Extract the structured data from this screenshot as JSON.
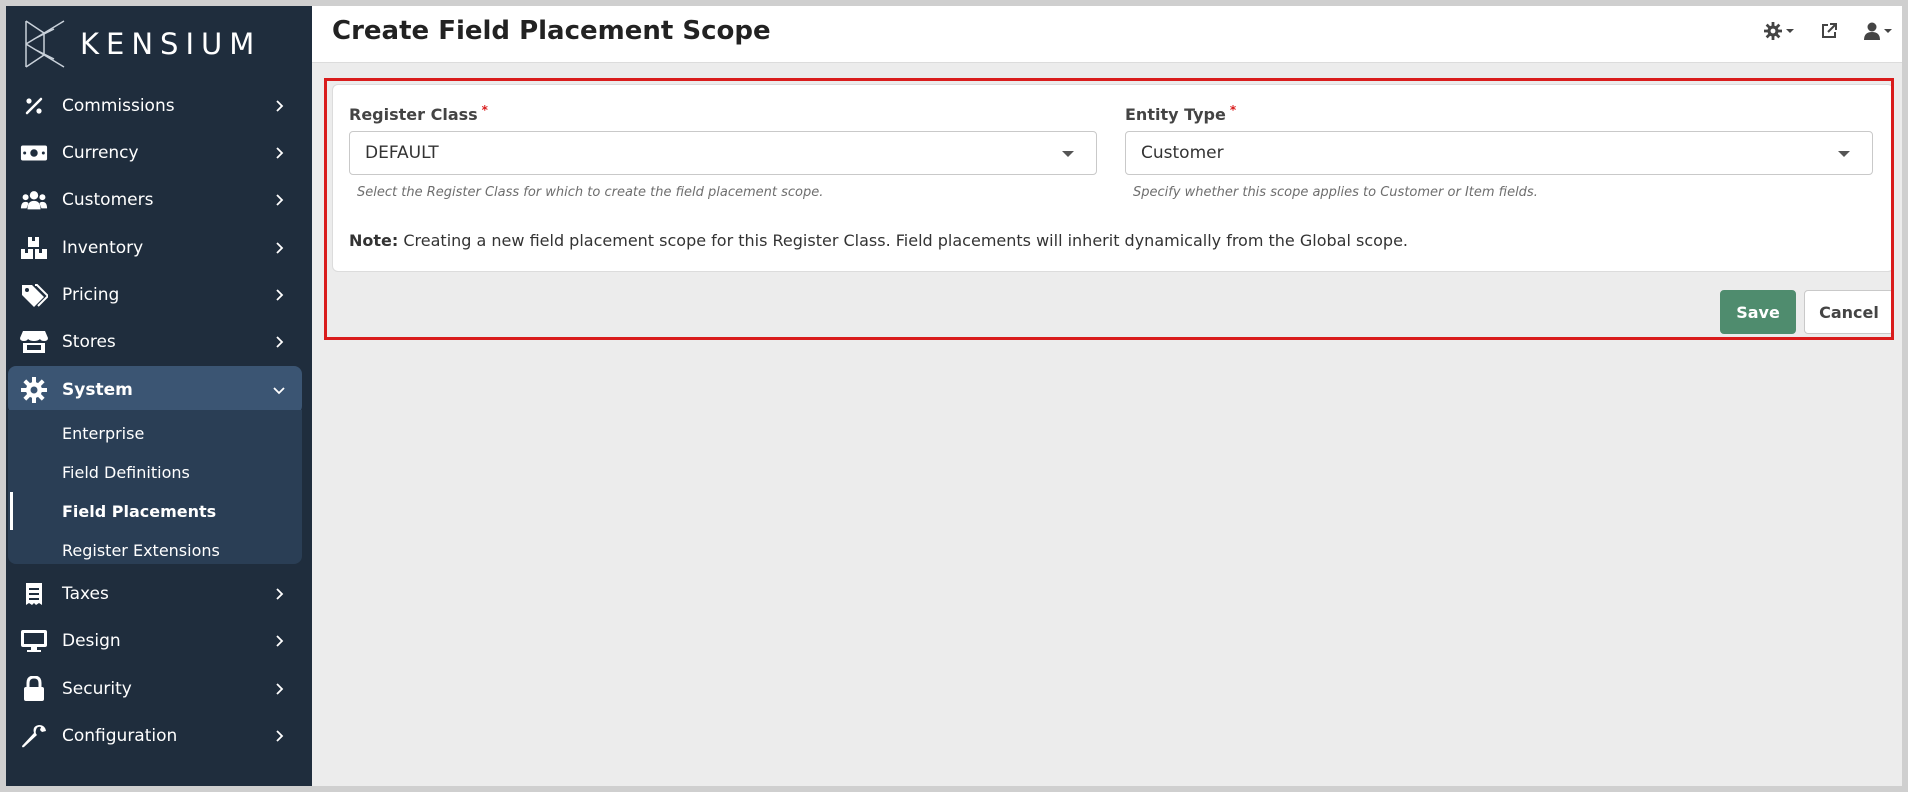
{
  "brand": {
    "name": "KENSIUM"
  },
  "sidebar": {
    "items": [
      {
        "label": "Commissions",
        "icon": "percent-icon"
      },
      {
        "label": "Currency",
        "icon": "money-bill-icon"
      },
      {
        "label": "Customers",
        "icon": "users-icon"
      },
      {
        "label": "Inventory",
        "icon": "boxes-icon"
      },
      {
        "label": "Pricing",
        "icon": "tags-icon"
      },
      {
        "label": "Stores",
        "icon": "store-icon"
      },
      {
        "label": "System",
        "icon": "gear-icon",
        "expanded": true
      },
      {
        "label": "Taxes",
        "icon": "receipt-icon"
      },
      {
        "label": "Design",
        "icon": "monitor-icon"
      },
      {
        "label": "Security",
        "icon": "lock-icon"
      },
      {
        "label": "Configuration",
        "icon": "wrench-icon"
      }
    ],
    "system_submenu": [
      {
        "label": "Enterprise"
      },
      {
        "label": "Field Definitions"
      },
      {
        "label": "Field Placements",
        "current": true
      },
      {
        "label": "Register Extensions"
      }
    ]
  },
  "header": {
    "title": "Create Field Placement Scope",
    "icons": [
      "gear-dropdown-icon",
      "external-link-icon",
      "user-dropdown-icon"
    ]
  },
  "form": {
    "register_class": {
      "label": "Register Class",
      "required_mark": "*",
      "value": "DEFAULT",
      "hint": "Select the Register Class for which to create the field placement scope."
    },
    "entity_type": {
      "label": "Entity Type",
      "required_mark": "*",
      "value": "Customer",
      "hint": "Specify whether this scope applies to Customer or Item fields."
    },
    "note_prefix": "Note:",
    "note_text": "Creating a new field placement scope for this Register Class. Field placements will inherit dynamically from the Global scope."
  },
  "actions": {
    "save_label": "Save",
    "cancel_label": "Cancel"
  },
  "colors": {
    "sidebar_bg": "#1f2d3d",
    "active_item": "#3b5573",
    "save_button": "#4f8c6e",
    "highlight_outline": "#d91c1c"
  }
}
